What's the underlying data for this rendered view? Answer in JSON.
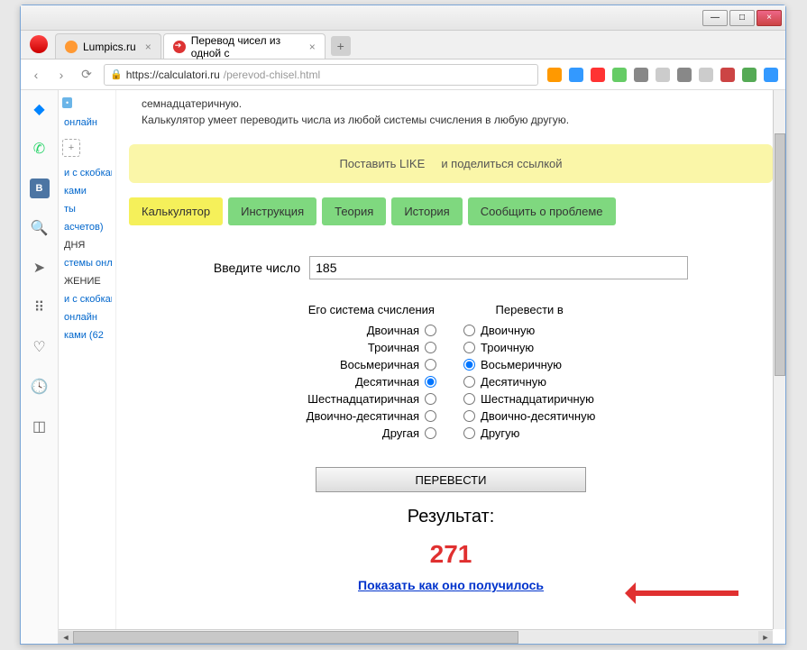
{
  "window": {
    "min": "—",
    "max": "□",
    "close": "×"
  },
  "tabs": [
    {
      "label": "Lumpics.ru",
      "active": false
    },
    {
      "label": "Перевод чисел из одной с",
      "active": true
    }
  ],
  "nav": {
    "back": "‹",
    "fwd": "›",
    "reload": "⟳",
    "url_host": "https://calculatori.ru",
    "url_path": "/perevod-chisel.html"
  },
  "rail": {
    "vk": "B"
  },
  "sidebar": {
    "items": [
      "онлайн",
      "и с скобками )",
      "ками",
      "ты",
      "асчетов)",
      "ДНЯ",
      "стемы онлайн",
      "ЖЕНИЕ",
      "и с скобками",
      "онлайн",
      "ками (62"
    ]
  },
  "intro": {
    "line1": "семнадцатеричную.",
    "line2": "Калькулятор умеет переводить числа из любой системы счисления в любую другую."
  },
  "like_bar": {
    "like": "Поставить LIKE",
    "share": "и поделиться ссылкой"
  },
  "page_tabs": [
    {
      "label": "Калькулятор",
      "active": true
    },
    {
      "label": "Инструкция",
      "active": false
    },
    {
      "label": "Теория",
      "active": false
    },
    {
      "label": "История",
      "active": false
    },
    {
      "label": "Сообщить о проблеме",
      "active": false
    }
  ],
  "calc": {
    "input_label": "Введите число",
    "input_value": "185",
    "from_header": "Его система счисления",
    "to_header": "Перевести в",
    "from_options": [
      "Двоичная",
      "Троичная",
      "Восьмеричная",
      "Десятичная",
      "Шестнадцатиричная",
      "Двоично-десятичная",
      "Другая"
    ],
    "to_options": [
      "Двоичную",
      "Троичную",
      "Восьмеричную",
      "Десятичную",
      "Шестнадцатиричную",
      "Двоично-десятичную",
      "Другую"
    ],
    "from_selected": 3,
    "to_selected": 2,
    "button": "ПЕРЕВЕСТИ",
    "result_label": "Результат:",
    "result_value": "271",
    "show_how": "Показать как оно получилось"
  },
  "ext_colors": [
    "#f90",
    "#39f",
    "#f33",
    "#6c6",
    "#888",
    "#ccc",
    "#888",
    "#ccc",
    "#c44",
    "#5a5",
    "#39f"
  ]
}
